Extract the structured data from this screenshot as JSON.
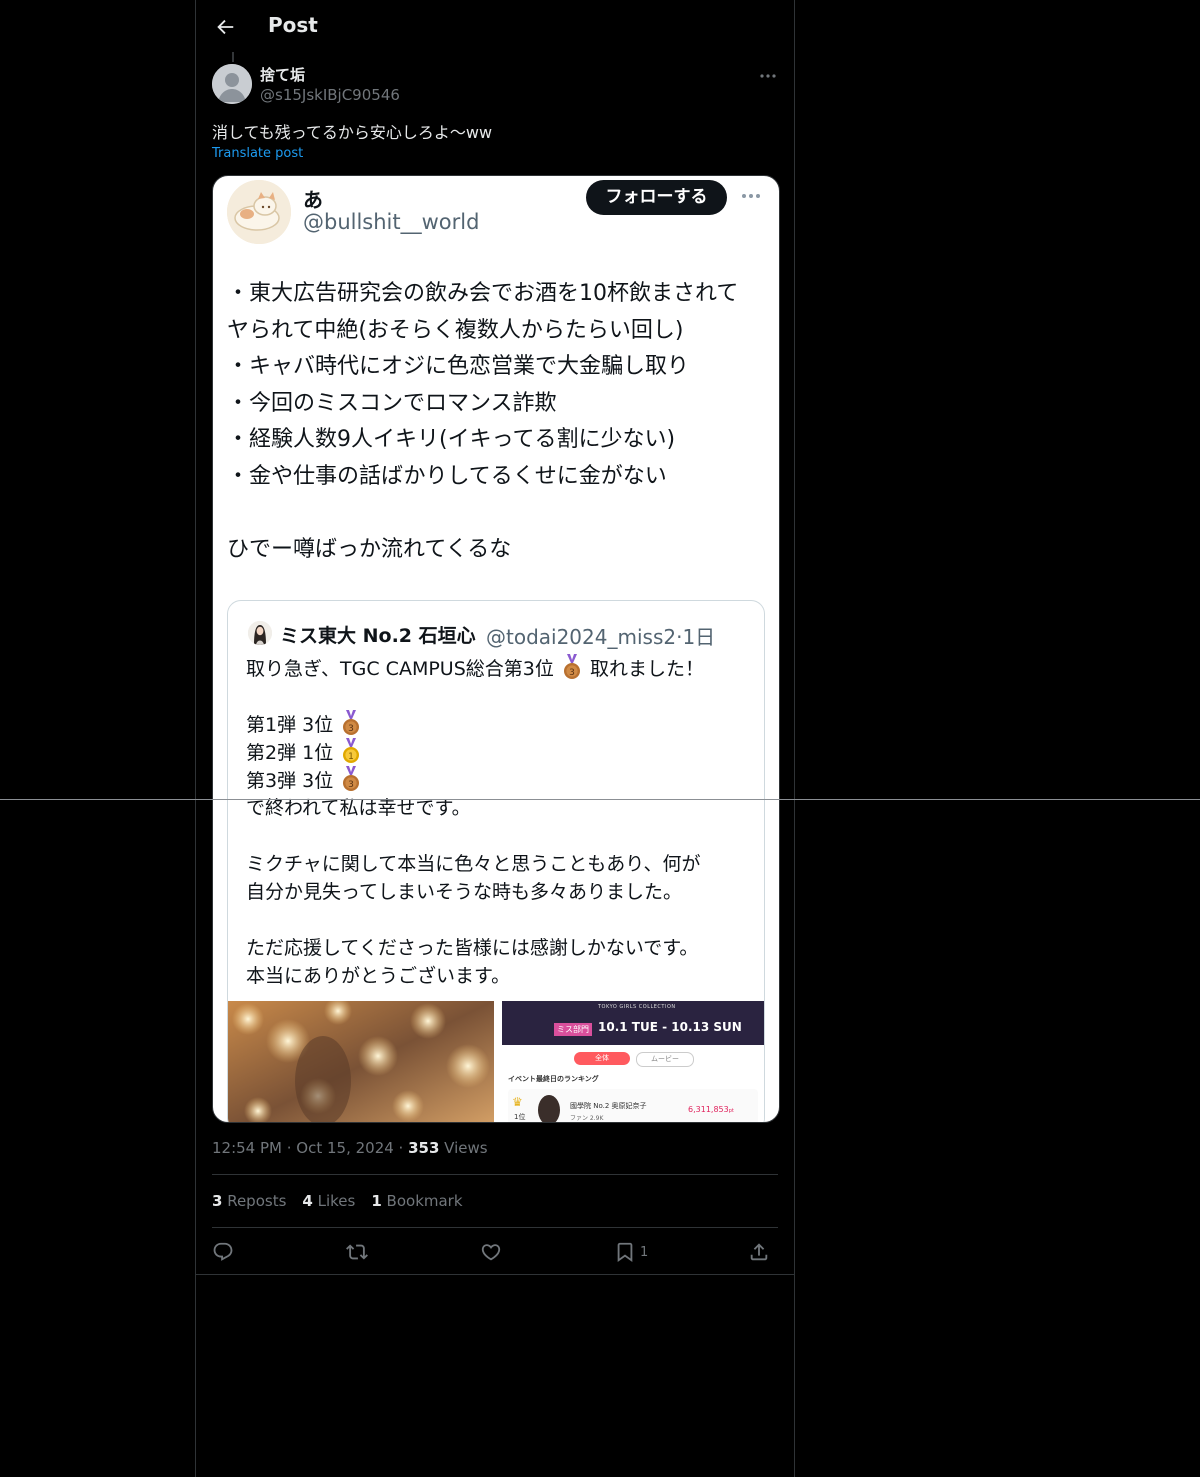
{
  "header": {
    "title": "Post"
  },
  "post": {
    "author_name": "捨て垢",
    "author_handle": "@s15JskIBjC90546",
    "text": "消しても残ってるから安心しろよ〜ww",
    "translate_label": "Translate post",
    "timestamp": "12:54 PM · Oct 15, 2024 · ",
    "views_count": "353",
    "views_label": " Views",
    "stats": {
      "reposts_count": "3",
      "reposts_label": " Reposts",
      "likes_count": "4",
      "likes_label": " Likes",
      "bookmarks_count": "1",
      "bookmarks_label": " Bookmark"
    },
    "actions": {
      "bookmark_count": "1"
    }
  },
  "embedded_screenshot": {
    "author_name": "あ",
    "author_handle": "@bullshit__world",
    "follow_label": "フォローする",
    "lines": [
      "・東大広告研究会の飲み会でお酒を10杯飲まされて",
      "ヤられて中絶(おそらく複数人からたらい回し)",
      "・キャバ時代にオジに色恋営業で大金騙し取り",
      "・今回のミスコンでロマンス詐欺",
      "・経験人数9人イキリ(イキってる割に少ない)",
      "・金や仕事の話ばかりしてるくせに金がない",
      "",
      "ひでー噂ばっか流れてくるな"
    ],
    "quote": {
      "author_name": "ミス東大 No.2 石垣心",
      "author_handle": "@todai2024_miss2",
      "time": "·1日",
      "line1_before": "取り急ぎ、TGC CAMPUS総合第3位",
      "line1_after": "取れました！",
      "ranks": [
        {
          "text": "第1弾 3位",
          "medal": "3"
        },
        {
          "text": "第2弾 1位",
          "medal": "1"
        },
        {
          "text": "第3弾 3位",
          "medal": "3"
        }
      ],
      "line_end": "で終われて私は幸せです。",
      "para2": [
        "ミクチャに関して本当に色々と思うこともあり、何が",
        "自分か見失ってしまいそうな時も多々ありました。"
      ],
      "para3": [
        "ただ応援してくださった皆様には感謝しかないです。",
        "本当にありがとうございます。"
      ],
      "media_right": {
        "banner_category": "ミス部門",
        "banner_dates": "10.1 TUE - 10.13 SUN",
        "banner_title": "TOKYO GIRLS COLLECTION",
        "tab_all": "全体",
        "tab_movie": "ムービー",
        "ranking_heading": "イベント最終日のランキング",
        "rank_label": "1位",
        "entry_name": "國學院 No.2 奥原妃奈子",
        "entry_fans": "ファン 2.9K",
        "entry_points": "6,311,853",
        "entry_points_unit": "pt"
      }
    }
  },
  "colors": {
    "background": "#000000",
    "accent": "#1d9bf0",
    "muted": "#71767b",
    "border": "#2f3336",
    "text": "#e7e9ea"
  }
}
